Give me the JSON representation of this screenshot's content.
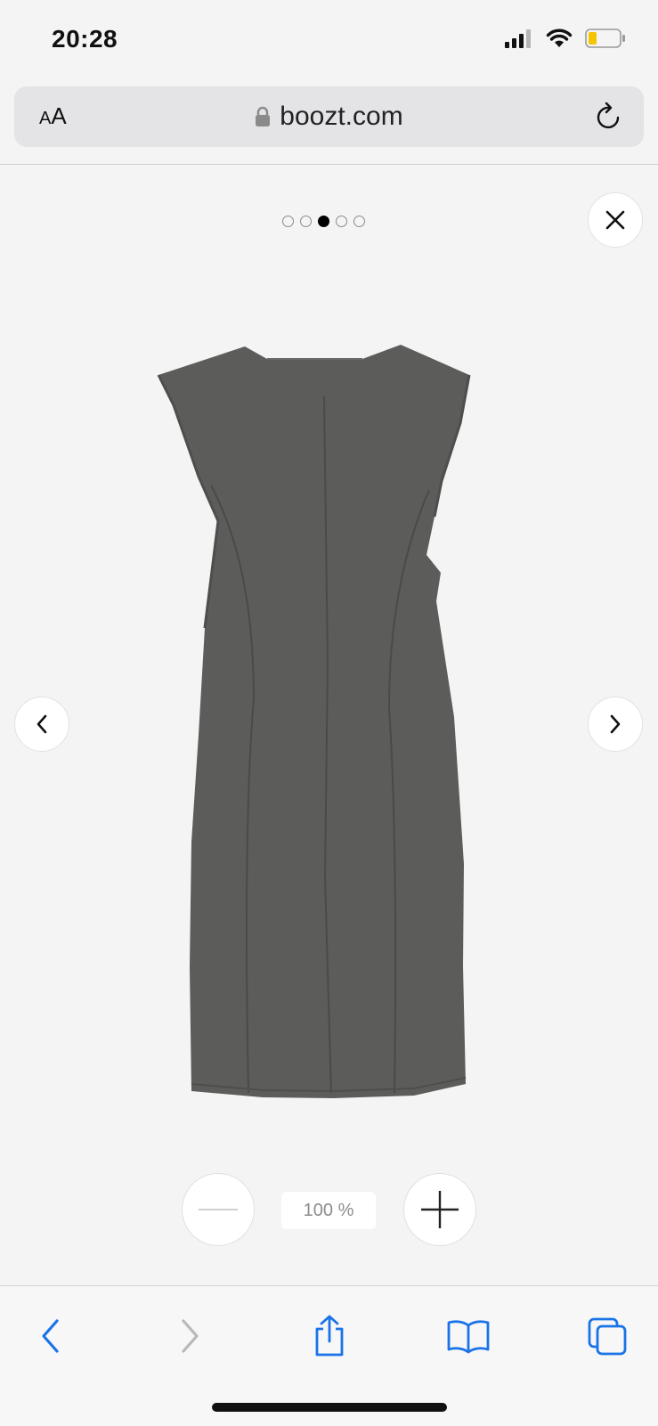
{
  "status_bar": {
    "time": "20:28"
  },
  "address_bar": {
    "text_size_label_small": "A",
    "text_size_label_large": "A",
    "domain": "boozt.com"
  },
  "gallery": {
    "total_images": 5,
    "active_index": 2,
    "zoom_level": "100 %"
  },
  "colors": {
    "ios_blue": "#1a73e8",
    "dress": "#5c5c5a",
    "background": "#f4f4f4"
  },
  "icons": {
    "close": "close-icon",
    "prev": "chevron-left-icon",
    "next": "chevron-right-icon",
    "zoom_out": "minus-icon",
    "zoom_in": "plus-icon"
  }
}
